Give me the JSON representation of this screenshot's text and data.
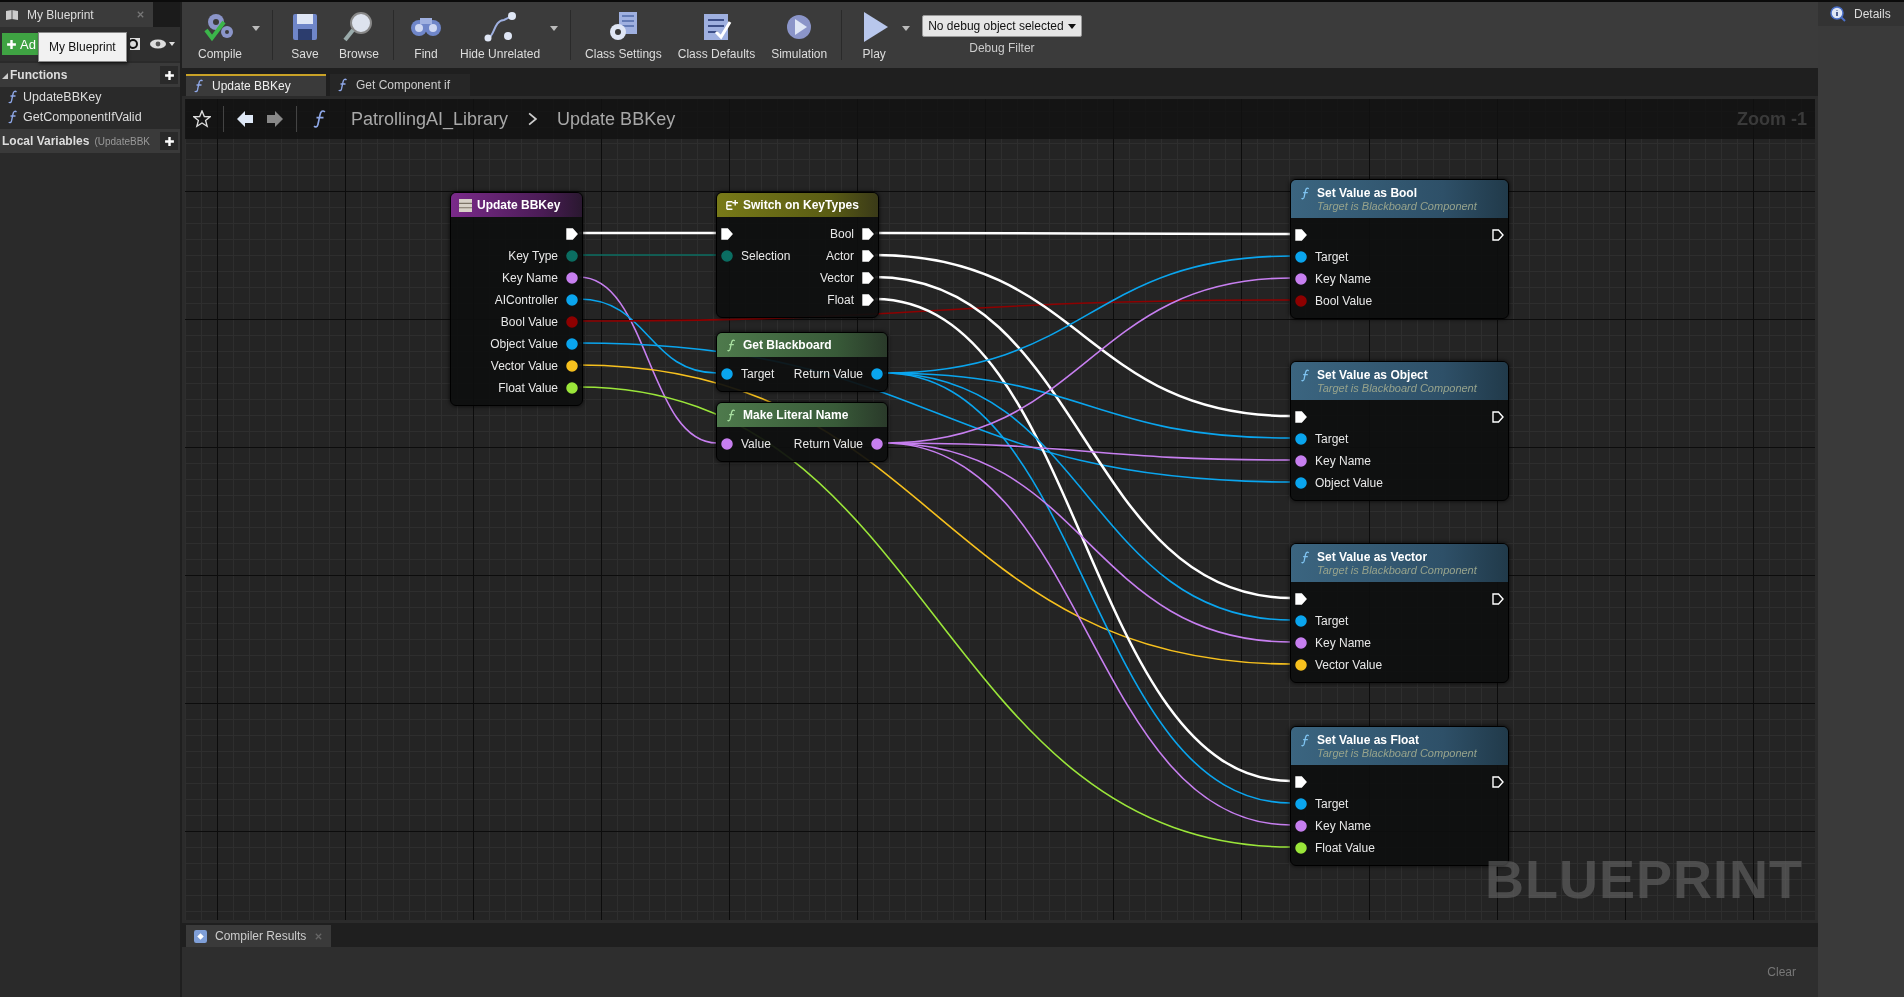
{
  "left_panel": {
    "tab": "My Blueprint",
    "add_button": "Ad",
    "tooltip": "My Blueprint",
    "sections": [
      {
        "title": "Functions",
        "items": [
          "UpdateBBKey",
          "GetComponentIfValid"
        ]
      },
      {
        "title": "Local Variables",
        "note": "(UpdateBBK"
      }
    ]
  },
  "toolbar": {
    "buttons": [
      {
        "label": "Compile",
        "kind": "compile",
        "menu": true
      },
      {
        "label": "Save",
        "kind": "save",
        "menu": false
      },
      {
        "label": "Browse",
        "kind": "browse",
        "menu": false
      },
      {
        "label": "Find",
        "kind": "find",
        "menu": false
      },
      {
        "label": "Hide Unrelated",
        "kind": "hide",
        "menu": true
      },
      {
        "label": "Class Settings",
        "kind": "settings",
        "menu": false
      },
      {
        "label": "Class Defaults",
        "kind": "defaults",
        "menu": false
      },
      {
        "label": "Simulation",
        "kind": "simulation",
        "menu": false
      },
      {
        "label": "Play",
        "kind": "play",
        "menu": true
      }
    ],
    "debug_filter": {
      "value": "No debug object selected",
      "label": "Debug Filter"
    }
  },
  "document_tabs": [
    {
      "label": "Update BBKey",
      "selected": true
    },
    {
      "label": "Get Component if",
      "selected": false
    }
  ],
  "breadcrumb": [
    "PatrollingAI_Library",
    "Update BBKey"
  ],
  "zoom": "Zoom -1",
  "nodes": [
    {
      "kind": "event",
      "title": "Update BBKey",
      "outputs": [
        {
          "kind": "exec",
          "connected": true
        },
        {
          "kind": "data",
          "label": "Key Type",
          "color": "#0b6e62",
          "connected": true
        },
        {
          "kind": "data",
          "label": "Key Name",
          "color": "#c77ff0",
          "connected": true
        },
        {
          "kind": "data",
          "label": "AIController",
          "color": "#0aa5ee",
          "connected": true
        },
        {
          "kind": "data",
          "label": "Bool Value",
          "color": "#8e0000",
          "connected": true
        },
        {
          "kind": "data",
          "label": "Object Value",
          "color": "#0aa5ee",
          "connected": true
        },
        {
          "kind": "data",
          "label": "Vector Value",
          "color": "#f7c11e",
          "connected": true
        },
        {
          "kind": "data",
          "label": "Float Value",
          "color": "#9be63a",
          "connected": true
        }
      ]
    },
    {
      "kind": "switch",
      "title": "Switch on KeyTypes",
      "inputs": [
        {
          "kind": "exec",
          "connected": true
        },
        {
          "kind": "data",
          "label": "Selection",
          "color": "#0b6e62",
          "connected": true
        }
      ],
      "outputs": [
        {
          "kind": "exec",
          "label": "Bool",
          "connected": true
        },
        {
          "kind": "exec",
          "label": "Actor",
          "connected": true
        },
        {
          "kind": "exec",
          "label": "Vector",
          "connected": true
        },
        {
          "kind": "exec",
          "label": "Float",
          "connected": true
        }
      ]
    },
    {
      "kind": "pure",
      "title": "Get Blackboard",
      "inputs": [
        {
          "kind": "data",
          "label": "Target",
          "color": "#0aa5ee",
          "connected": true
        }
      ],
      "outputs": [
        {
          "kind": "data",
          "label": "Return Value",
          "color": "#0aa5ee",
          "connected": true
        }
      ]
    },
    {
      "kind": "pure",
      "title": "Make Literal Name",
      "inputs": [
        {
          "kind": "data",
          "label": "Value",
          "color": "#c77ff0",
          "connected": true
        }
      ],
      "outputs": [
        {
          "kind": "data",
          "label": "Return Value",
          "color": "#c77ff0",
          "connected": true
        }
      ]
    },
    {
      "kind": "function",
      "title": "Set Value as Bool",
      "subtitle": "Target is Blackboard Component",
      "inputs": [
        {
          "kind": "exec",
          "connected": true
        },
        {
          "kind": "data",
          "label": "Target",
          "color": "#0aa5ee",
          "connected": true
        },
        {
          "kind": "data",
          "label": "Key Name",
          "color": "#c77ff0",
          "connected": true
        },
        {
          "kind": "data",
          "label": "Bool Value",
          "color": "#8e0000",
          "connected": true
        }
      ],
      "outputs": [
        {
          "kind": "exec",
          "connected": false
        }
      ]
    },
    {
      "kind": "function",
      "title": "Set Value as Object",
      "subtitle": "Target is Blackboard Component",
      "inputs": [
        {
          "kind": "exec",
          "connected": true
        },
        {
          "kind": "data",
          "label": "Target",
          "color": "#0aa5ee",
          "connected": true
        },
        {
          "kind": "data",
          "label": "Key Name",
          "color": "#c77ff0",
          "connected": true
        },
        {
          "kind": "data",
          "label": "Object Value",
          "color": "#0aa5ee",
          "connected": true
        }
      ],
      "outputs": [
        {
          "kind": "exec",
          "connected": false
        }
      ]
    },
    {
      "kind": "function",
      "title": "Set Value as Vector",
      "subtitle": "Target is Blackboard Component",
      "inputs": [
        {
          "kind": "exec",
          "connected": true
        },
        {
          "kind": "data",
          "label": "Target",
          "color": "#0aa5ee",
          "connected": true
        },
        {
          "kind": "data",
          "label": "Key Name",
          "color": "#c77ff0",
          "connected": true
        },
        {
          "kind": "data",
          "label": "Vector Value",
          "color": "#f7c11e",
          "connected": true
        }
      ],
      "outputs": [
        {
          "kind": "exec",
          "connected": false
        }
      ]
    },
    {
      "kind": "function",
      "title": "Set Value as Float",
      "subtitle": "Target is Blackboard Component",
      "inputs": [
        {
          "kind": "exec",
          "connected": true
        },
        {
          "kind": "data",
          "label": "Target",
          "color": "#0aa5ee",
          "connected": true
        },
        {
          "kind": "data",
          "label": "Key Name",
          "color": "#c77ff0",
          "connected": true
        },
        {
          "kind": "data",
          "label": "Float Value",
          "color": "#9be63a",
          "connected": true
        }
      ],
      "outputs": [
        {
          "kind": "exec",
          "connected": false
        }
      ]
    }
  ],
  "graph_label": "BLUEPRINT",
  "compiler_results": {
    "tab": "Compiler Results",
    "clear": "Clear"
  },
  "details": {
    "tab": "Details"
  }
}
